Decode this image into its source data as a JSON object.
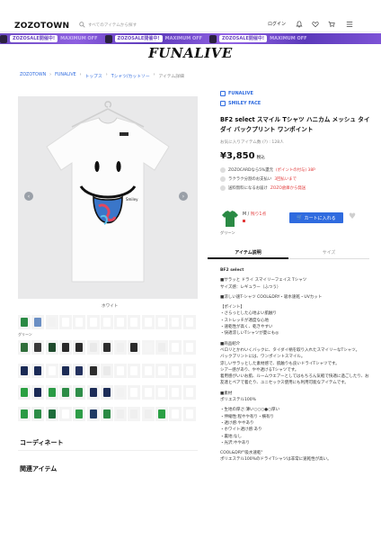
{
  "header": {
    "logo": "ZOZOTOWN",
    "search_placeholder": "すべてのアイテムから探す",
    "login": "ログイン",
    "icons": [
      "bell-icon",
      "heart-icon",
      "cart-icon",
      "menu-icon"
    ]
  },
  "banner": {
    "items": [
      "ZOZOSALE開催中!",
      "MAXIMUM OFF",
      "ZOZOSALE開催中!",
      "MAXIMUM OFF",
      "ZOZOSALE開催中!",
      "MAXIMUM OFF"
    ]
  },
  "shop_title": "FUNALIVE",
  "breadcrumb": [
    "ZOZOTOWN",
    "FUNALIVE",
    "トップス",
    "Tシャツ/カットソー",
    "アイテム詳細"
  ],
  "gallery": {
    "color_caption": "ホワイト",
    "thumb_colors": [
      [
        "#2a8a44",
        "#6b8fc4",
        "#f2f2f2",
        "#ffffff",
        "#ffffff",
        "#ffffff",
        "#ffffff",
        "#ffffff",
        "#ffffff",
        "#ffffff",
        "#ffffff",
        "#ffffff",
        "#ffffff"
      ],
      [
        "#2f6e3a",
        "#3a3a3a",
        "#1e4a2c",
        "#2a2a2a",
        "#2b2b2b",
        "#e9e9e9",
        "#2e2e2e",
        "#f0f0f0",
        "#2a2a2a",
        "#f5f5f5",
        "#eee",
        "#fff",
        "#fff"
      ],
      [
        "#1a2a55",
        "#1b2b57",
        "#ffffff",
        "#1c2c56",
        "#23315e",
        "#2d2d2d",
        "#eaeaea",
        "#fff",
        "#fff",
        "#fff",
        "#fff",
        "#fff",
        "#fff"
      ],
      [
        "#2aa041",
        "#1b2a55",
        "#2a9b45",
        "#2c8c46",
        "#2e8e49",
        "#1c2c57",
        "#1d2d58",
        "#f2f2f2",
        "#ffffff",
        "#fff",
        "#fff",
        "#fff",
        "#fff"
      ],
      [
        "#2a9a44",
        "#2c8c46",
        "#1e6e3b",
        "#ffffff",
        "#2d9d47",
        "#1f3a64",
        "#2a8a44",
        "#efefef",
        "#efefef",
        "#efefef",
        "#2aa044",
        "#fff",
        "#fff"
      ]
    ],
    "green_label": "グリーン"
  },
  "sections": {
    "coordinate": "コーディネート",
    "related": "関連アイテム"
  },
  "product": {
    "brand": "FUNALIVE",
    "brand2": "SMILEY FACE",
    "name": "BF2 select スマイル Tシャツ ハニカム メッシュ タイダイ バックプリント ワンポイント",
    "stock": "お気に入りアイテム数 (?) : 128人",
    "price": "¥3,850",
    "tax": "税込",
    "info": [
      {
        "text": "ZOZOCARDなら5%還元 ",
        "highlight": "(ポイントの付与) 38P"
      },
      {
        "text": "ラクラク分割のお支払い",
        "highlight": "3回払いまで"
      },
      {
        "text": "送料無料になるお届け",
        "highlight": "ZOZO倉庫から発送"
      }
    ],
    "color_label": "グリーン",
    "size_label": "M / ",
    "stock_left": "残り1点",
    "cart": "カートに入れる"
  },
  "tabs": [
    "アイテム説明",
    "サイズ"
  ],
  "description": [
    "BF2 select",
    "",
    "■サラッと ドライ スマイリーフェイス Tシャツ",
    "サイズ感：レギュラー（ふつう）",
    "",
    "■涼しい速T-シャツ COOL&DRY・吸水速乾・UVカット",
    "",
    "【ポイント】",
    "・さらっとした心地よい肌触り",
    "・ストレッチが適度な心地",
    "・速乾性が高く、乾きやすい",
    "・快適涼しいTシャツが夏にも◎",
    "",
    "■商品紹介",
    "ベロリとかわいくバックに、タイダイ柄を取り入れたスマイリーなTシャツ。",
    "バックプリントには、ワンポイントスマイル。",
    "涼しいサラッとした素材感で、肌触りも良いドライTシャツです。",
    "シアー感があり、やや透けるTシャツです。",
    "着用感がいいお肌、ルームウエアーとしてはもちろん気軽で快適に過ごしたり、お友達とペアで着たり、ユニセックス使用にも利用可能なアイテムです。",
    "",
    "■素材",
    "ポリエステル100%",
    "",
    "・生地の厚さ:薄い○○○●○厚い",
    "・伸縮性:程やや有り・横有り",
    "・透け感:ややあり",
    "・ホワイト透け感:あり",
    "・裏地:なし",
    "・光沢:ややあり",
    "",
    "COOL&DRY\"吸水速乾\"",
    "ポリエステル100%のドライTシャツは非常に速乾性が高い。"
  ]
}
